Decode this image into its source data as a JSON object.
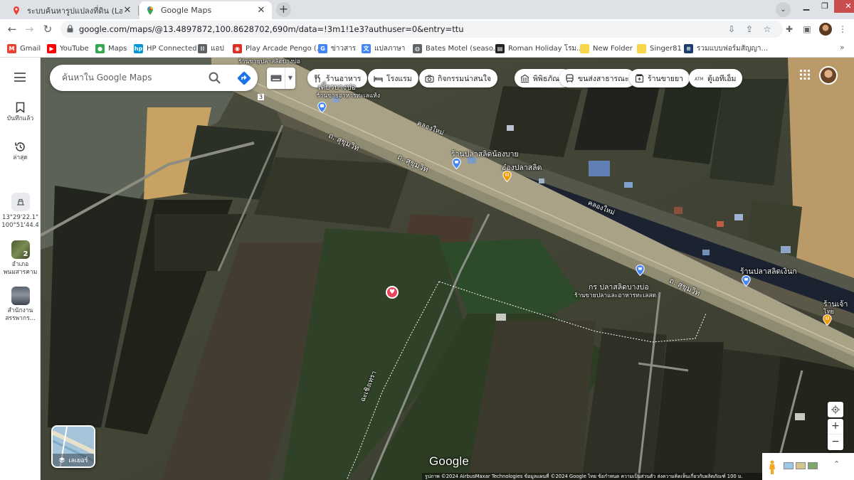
{
  "browser": {
    "tabs": [
      {
        "title": "ระบบค้นหารูปแปลงที่ดิน (LandsMa",
        "active": false
      },
      {
        "title": "Google Maps",
        "active": true
      }
    ],
    "url": "google.com/maps/@13.4897872,100.8628702,690m/data=!3m1!1e3?authuser=0&entry=ttu",
    "bookmarks": [
      {
        "label": "Gmail",
        "icon": "gmail-icon",
        "color": "#ea4335"
      },
      {
        "label": "YouTube",
        "icon": "youtube-icon",
        "color": "#ff0000"
      },
      {
        "label": "Maps",
        "icon": "maps-icon",
        "color": "#34a853"
      },
      {
        "label": "HP Connected",
        "icon": "hp-icon",
        "color": "#0096d6"
      },
      {
        "label": "แอป",
        "icon": "apps-grid-icon",
        "color": "#5f6368"
      },
      {
        "label": "Play Arcade Pengo (...",
        "icon": "arcade-icon",
        "color": "#d93025"
      },
      {
        "label": "ข่าวสาร",
        "icon": "news-icon",
        "color": "#4285f4"
      },
      {
        "label": "แปลภาษา",
        "icon": "translate-icon",
        "color": "#4285f4"
      },
      {
        "label": "Bates Motel (seaso...",
        "icon": "globe-icon",
        "color": "#5f6368"
      },
      {
        "label": "Roman Holiday โรม...",
        "icon": "film-icon",
        "color": "#222222"
      },
      {
        "label": "New Folder",
        "icon": "folder-icon",
        "color": "#f9d648"
      },
      {
        "label": "Singer81",
        "icon": "folder-icon",
        "color": "#f9d648"
      },
      {
        "label": "รวมแบบฟอร์มสัญญา...",
        "icon": "document-icon",
        "color": "#1a3d6e"
      }
    ]
  },
  "maps": {
    "search_placeholder": "ค้นหาใน Google Maps",
    "rail": {
      "saved": "บันทึกแล้ว",
      "recent": "ล่าสุด",
      "coord_line1": "13°29'22.1\"",
      "coord_line2": "100°51'44.4",
      "place1_line1": "อำเภอ",
      "place1_line2": "พนมสารคาม",
      "place1_badge": "2",
      "place2_line1": "สำนักงาน",
      "place2_line2": "สรรพากร..."
    },
    "chips": [
      {
        "label": "ร้านอาหาร",
        "icon": "restaurant-icon"
      },
      {
        "label": "โรงแรม",
        "icon": "hotel-icon"
      },
      {
        "label": "กิจกรรมน่าสนใจ",
        "icon": "camera-icon"
      },
      {
        "label": "พิพิธภัณฑ์",
        "icon": "museum-icon"
      },
      {
        "label": "ขนส่งสาธารณะ",
        "icon": "transit-icon"
      },
      {
        "label": "ร้านขายยา",
        "icon": "pharmacy-icon"
      },
      {
        "label": "ตู้เอทีเอ็ม",
        "icon": "atm-icon"
      }
    ],
    "labels": {
      "top_cut": "ร้านขายปลาสลิดบางบ่อ",
      "top_a": "เตี๋ยวบางบ่อ",
      "top_b": "ร้านขายอาหารทะเลแห้ง",
      "klong1": "คลองใหม่",
      "klong2": "คลองใหม่",
      "road1": "ถ. สุขุมวิท",
      "road2": "ถ. สุขุมวิท",
      "road3": "ถ. สุขุมวิท",
      "shop1": "ร้านปลาสลิดน้องบาย",
      "shop2": "อ๋องปลาสลิด",
      "shop3a": "กร ปลาสลิดบางบ่อ",
      "shop3b": "ร้านขายปลาและอาหารทะเลสด",
      "shop4": "ร้านปลาสลิดเงินก",
      "shop5a": "ร้านเจ้า",
      "shop5b": "โทย",
      "field": "ฉะเชิงเทรา",
      "route_marker": "3"
    },
    "layers_label": "เลเยอร์",
    "google_logo": "Google",
    "attribution": "รูปภาพ ©2024 AirbusMaxar Technologies ข้อมูลแผนที่ ©2024 Google   ไทย   ข้อกำหนด   ความเป็นส่วนตัว   ส่งความคิดเห็นเกี่ยวกับผลิตภัณฑ์   100 ม.",
    "zoom_in": "+",
    "zoom_out": "−"
  }
}
